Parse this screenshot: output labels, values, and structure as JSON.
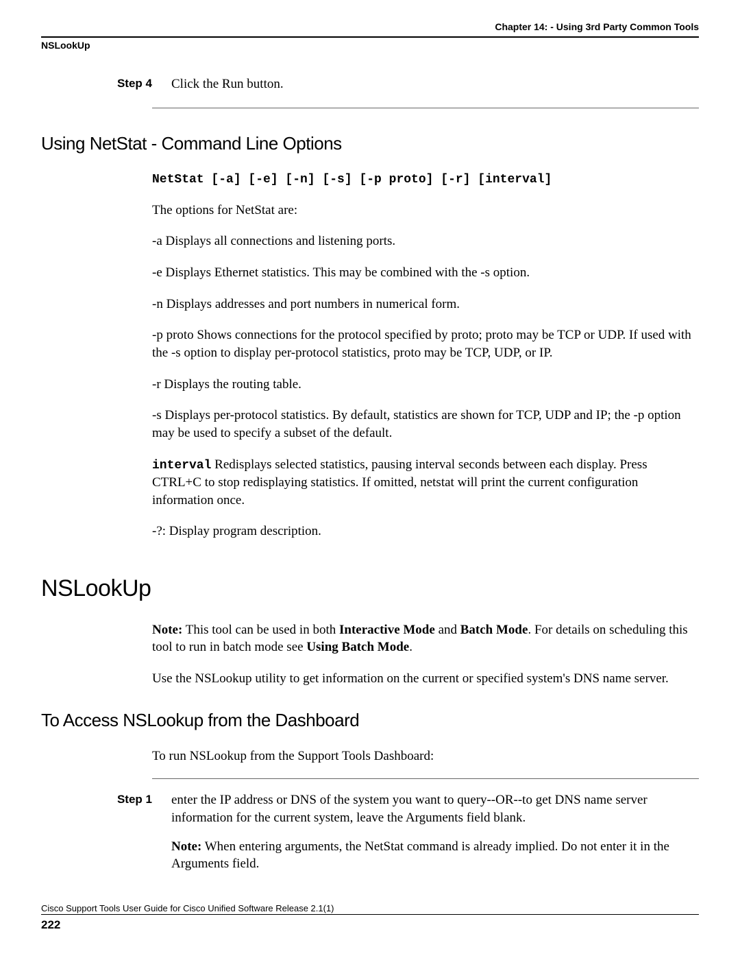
{
  "header": {
    "chapter": "Chapter 14: - Using 3rd Party Common Tools",
    "section": "NSLookUp"
  },
  "step4": {
    "label": "Step 4",
    "text": "Click the Run button."
  },
  "netstat": {
    "heading": "Using NetStat - Command Line Options",
    "syntax": "NetStat [-a] [-e] [-n] [-s] [-p proto] [-r] [interval]",
    "intro": "The options for NetStat are:",
    "opt_a": "-a Displays all connections and listening ports.",
    "opt_e": "-e Displays Ethernet statistics. This may be combined with the -s option.",
    "opt_n": "-n Displays addresses and port numbers in numerical form.",
    "opt_p": "-p proto Shows connections for the protocol specified by proto; proto may be TCP or UDP. If used with the -s option to display per-protocol statistics, proto may be TCP, UDP, or IP.",
    "opt_r": "-r Displays the routing table.",
    "opt_s": "-s Displays per-protocol statistics. By default, statistics are shown for TCP, UDP and IP; the -p option may be used to specify a subset of the default.",
    "interval_kw": "interval",
    "interval_rest": " Redisplays selected statistics, pausing interval seconds between each display. Press CTRL+C to stop redisplaying statistics. If omitted, netstat will print the current configuration information once.",
    "opt_q": "-?: Display program description."
  },
  "nslookup": {
    "heading": "NSLookUp",
    "note_prefix": "Note:",
    "note_part1": " This tool can be used in both ",
    "note_bold1": "Interactive Mode",
    "note_mid": " and ",
    "note_bold2": "Batch Mode",
    "note_part2": ". For details on scheduling this tool to run in batch mode see ",
    "note_bold3": "Using Batch Mode",
    "note_end": ".",
    "usage": "Use the NSLookup utility to get information on the current or specified system's DNS name server."
  },
  "access": {
    "heading": "To Access NSLookup from the Dashboard",
    "intro": "To run NSLookup from the Support Tools Dashboard:"
  },
  "step1": {
    "label": "Step 1",
    "text": "enter the IP address or DNS of the system you want to query--OR--to get DNS name server information for the current system, leave the Arguments field blank.",
    "note_prefix": "Note:",
    "note_rest": " When entering arguments, the NetStat command is already implied. Do not enter it in the Arguments field."
  },
  "footer": {
    "guide": "Cisco Support Tools User Guide for Cisco Unified Software Release 2.1(1)",
    "page": "222"
  }
}
